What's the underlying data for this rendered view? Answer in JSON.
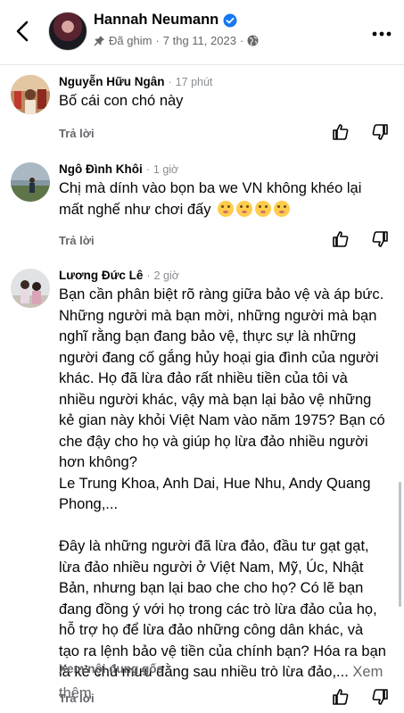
{
  "header": {
    "name": "Hannah Neumann",
    "pinned_label": "Đã ghim",
    "dot": "·",
    "date": "7 thg 11, 2023"
  },
  "comments": [
    {
      "name": "Nguyễn Hữu Ngân",
      "dot": "·",
      "time": "17 phút",
      "text": "Bố cái con chó này",
      "reply": "Trả lời"
    },
    {
      "name": "Ngô Đình Khôi",
      "dot": "·",
      "time": "1 giờ",
      "text": "Chị mà dính vào bọn ba we  VN không khéo lại mất nghế như chơi đấy",
      "reply": "Trả lời"
    },
    {
      "name": "Lương Đức Lê",
      "dot": "·",
      "time": "2 giờ",
      "text": "Bạn cần phân biệt rõ ràng giữa bảo vệ và áp bức. Những người mà bạn mời, những người mà bạn nghĩ rằng bạn đang bảo vệ, thực sự là những người đang cố gắng hủy hoại gia đình của người khác. Họ đã lừa đảo rất nhiều tiền của tôi và nhiều người khác, vậy mà bạn lại bảo vệ những kẻ gian này khỏi Việt Nam vào năm 1975? Bạn có che đậy cho họ và giúp họ lừa đảo nhiều người hơn không?\nLe Trung Khoa, Anh Dai, Hue Nhu, Andy Quang Phong,...\n\nĐây là những người đã lừa đảo, đầu tư gạt gạt, lừa đảo nhiều người ở Việt Nam, Mỹ, Úc, Nhật Bản, nhưng bạn lại bao che cho họ? Có lẽ bạn đang đồng ý với họ trong các trò lừa đảo của họ, hỗ trợ họ để lừa đảo những công dân khác, và tạo ra lệnh bảo vệ tiền của chính bạn? Hóa ra bạn là kẻ chủ mưu đằng sau nhiều trò lừa đảo,...",
      "see_more": "Xem thêm",
      "view_original": "Xem nội dung gốc",
      "reply": "Trả lời"
    }
  ]
}
